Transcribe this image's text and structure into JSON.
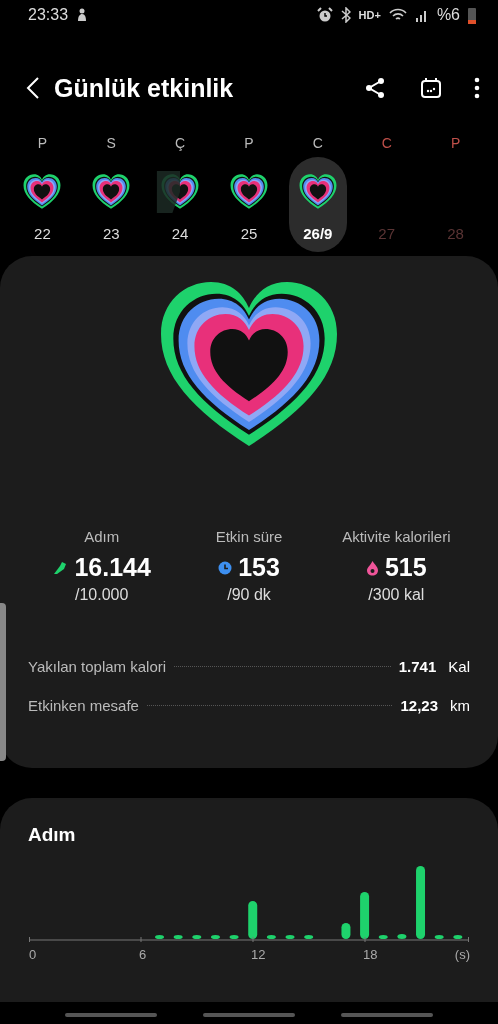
{
  "status_bar": {
    "time": "23:33",
    "network": "HD+",
    "battery": "%6"
  },
  "header": {
    "title": "Günlük etkinlik"
  },
  "week": [
    {
      "letter": "P",
      "date": "22",
      "kind": "complete",
      "weekend": false,
      "selected": false
    },
    {
      "letter": "S",
      "date": "23",
      "kind": "complete",
      "weekend": false,
      "selected": false
    },
    {
      "letter": "Ç",
      "date": "24",
      "kind": "partial",
      "weekend": false,
      "selected": false
    },
    {
      "letter": "P",
      "date": "25",
      "kind": "complete",
      "weekend": false,
      "selected": false
    },
    {
      "letter": "C",
      "date": "26/9",
      "kind": "complete",
      "weekend": false,
      "selected": true
    },
    {
      "letter": "C",
      "date": "27",
      "kind": "future",
      "weekend": true,
      "selected": false
    },
    {
      "letter": "P",
      "date": "28",
      "kind": "future",
      "weekend": true,
      "selected": false
    }
  ],
  "stats": [
    {
      "label": "Adım",
      "kind": "steps",
      "value": "16.144",
      "goal": "/10.000",
      "color": "#1ed26c"
    },
    {
      "label": "Etkin süre",
      "kind": "time",
      "value": "153",
      "goal": "/90 dk",
      "color": "#3d8ff0"
    },
    {
      "label": "Aktivite kalorileri",
      "kind": "calories",
      "value": "515",
      "goal": "/300 kal",
      "color": "#f0559a"
    }
  ],
  "details": [
    {
      "label": "Yakılan toplam kalori",
      "value": "1.741",
      "unit": "Kal"
    },
    {
      "label": "Etkinken mesafe",
      "value": "12,23",
      "unit": "km"
    }
  ],
  "steps_card": {
    "title": "Adım",
    "x_labels": [
      "0",
      "6",
      "12",
      "18",
      "(s)"
    ]
  }
}
